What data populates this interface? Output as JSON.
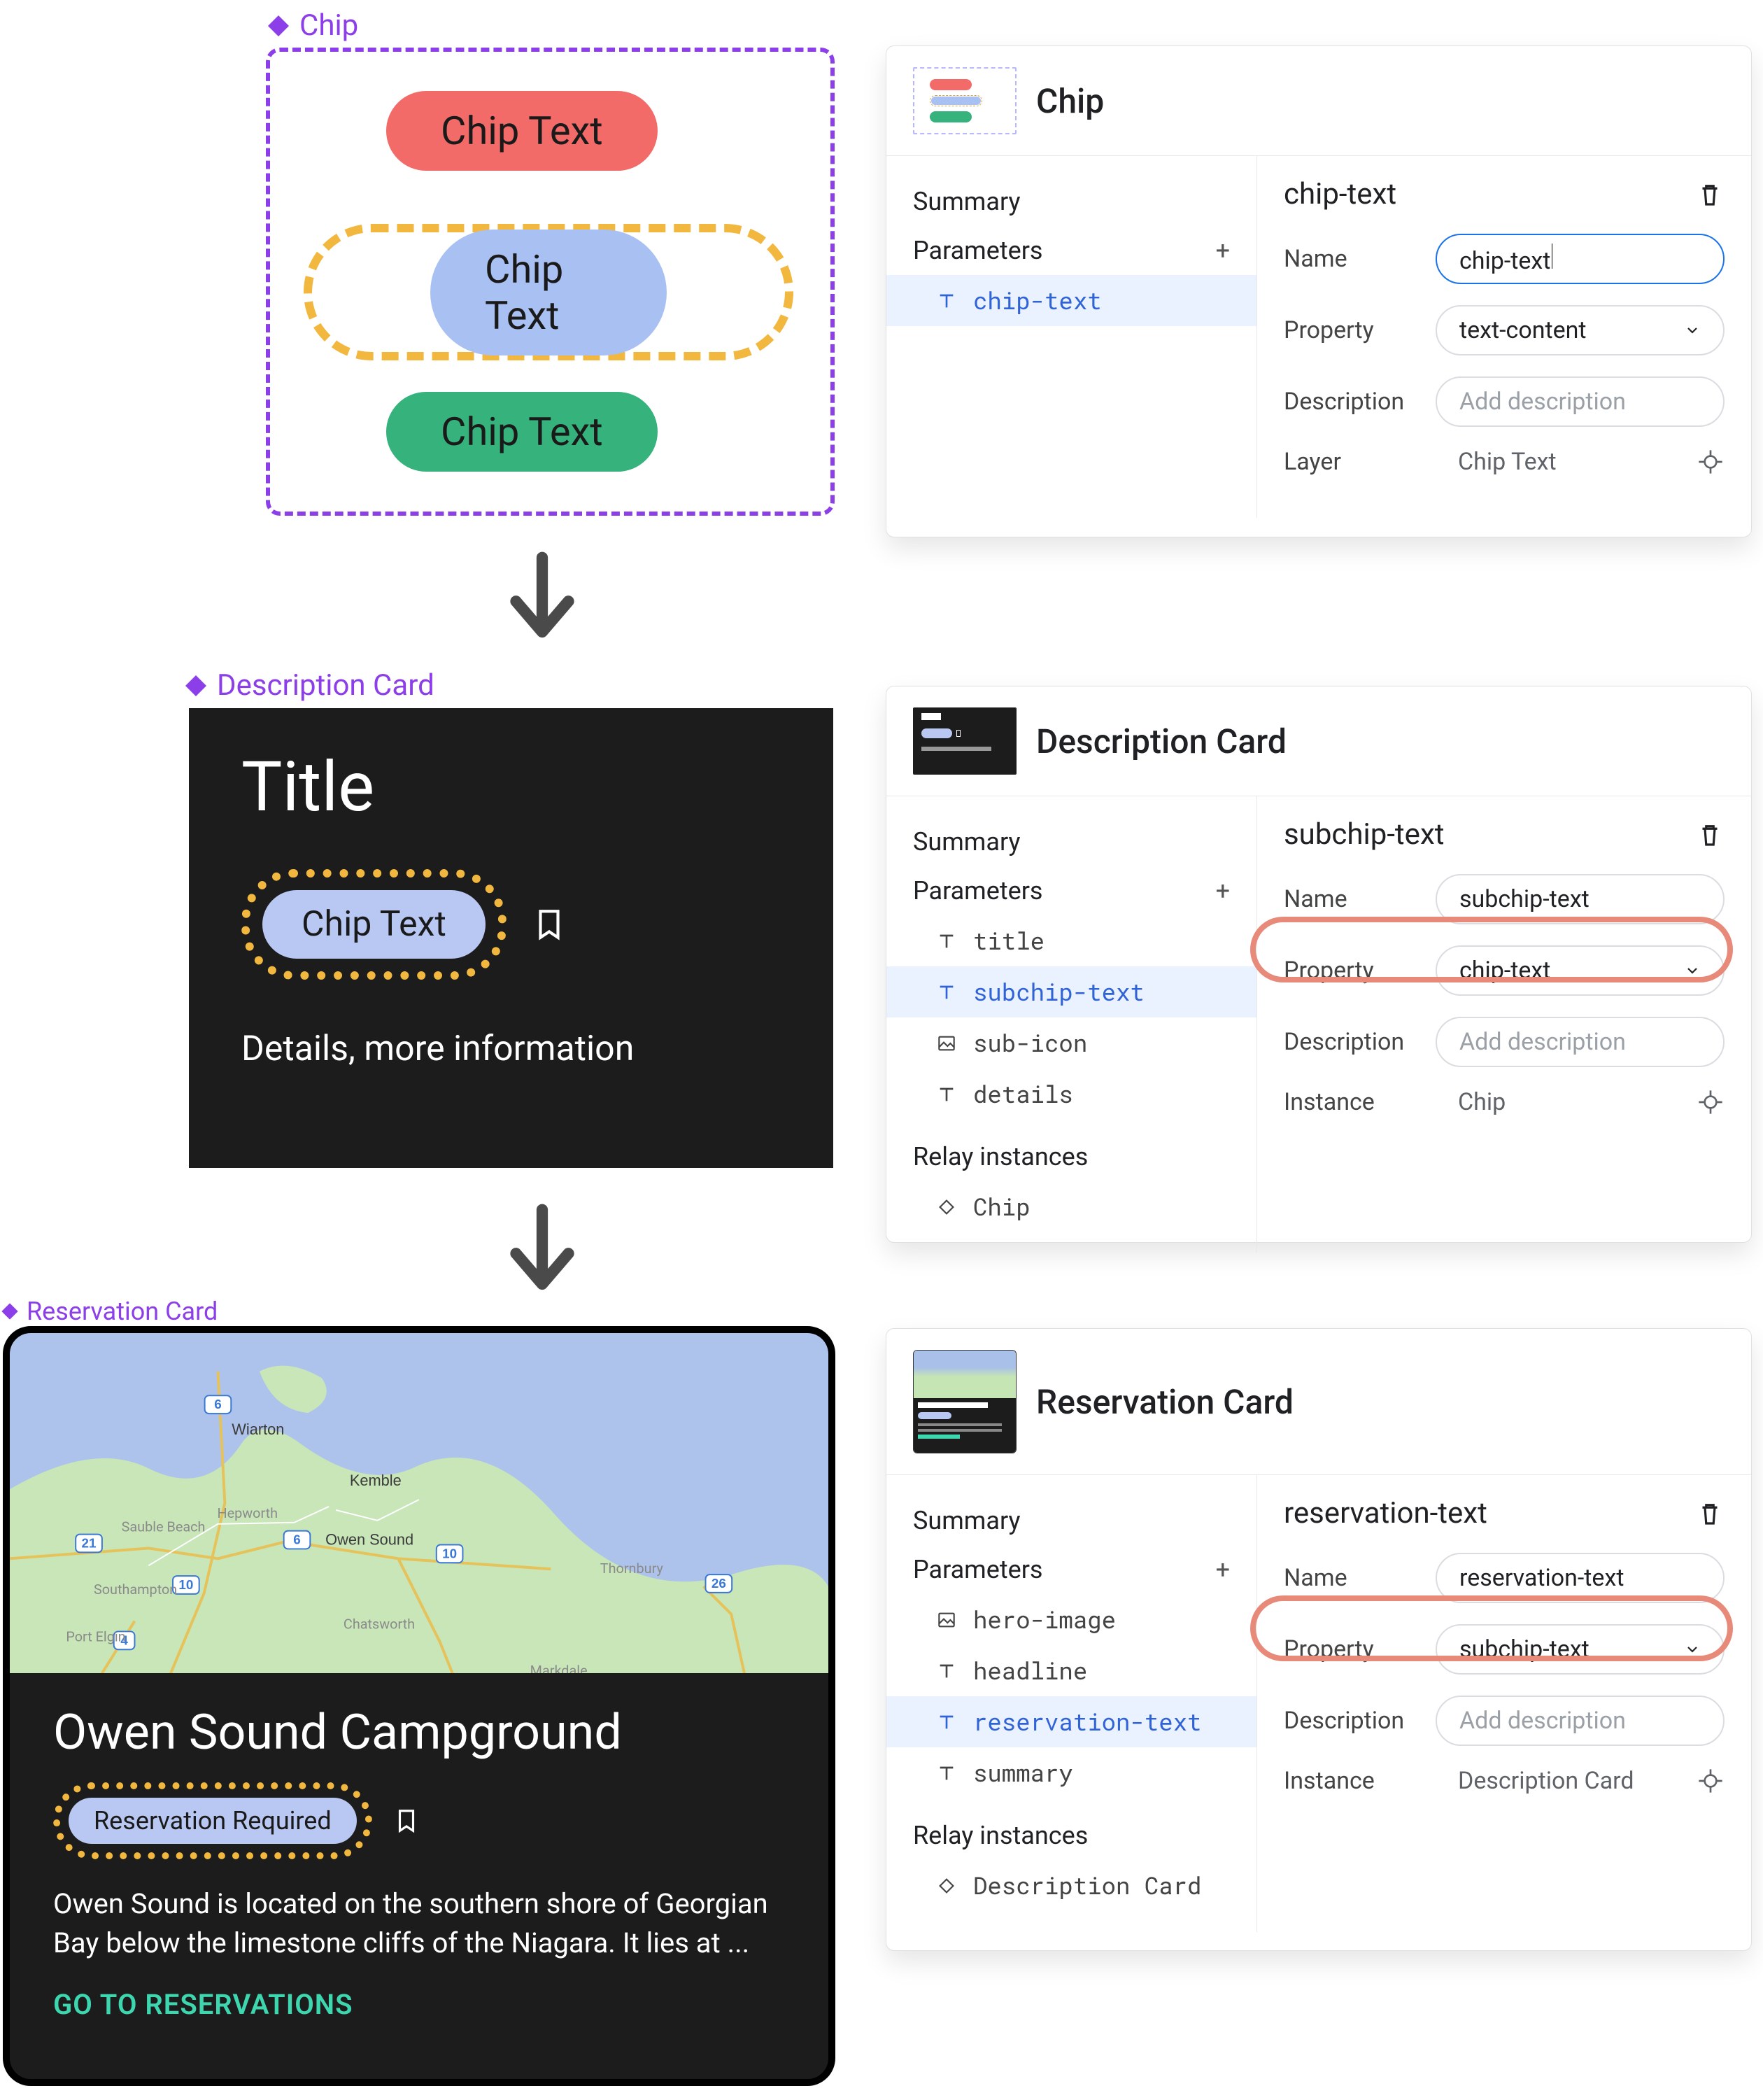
{
  "chip": {
    "label": "Chip",
    "red_text": "Chip Text",
    "blue_text": "Chip Text",
    "green_text": "Chip Text"
  },
  "description_card": {
    "label": "Description Card",
    "title": "Title",
    "chip_text": "Chip Text",
    "details": "Details, more information"
  },
  "reservation_card": {
    "label": "Reservation Card",
    "headline": "Owen Sound Campground",
    "chip_text": "Reservation Required",
    "summary": "Owen Sound is located on the southern shore of Georgian Bay below the limestone cliffs of the Niagara. It lies at ...",
    "cta": "GO TO RESERVATIONS",
    "map_places": [
      "Wiarton",
      "Kemble",
      "Sauble Beach",
      "Hepworth",
      "Owen Sound",
      "Southampton",
      "Chatsworth",
      "Port Elgin",
      "Markdale",
      "Thornbury"
    ],
    "map_roads": [
      "6",
      "10",
      "21",
      "6",
      "10",
      "26",
      "4"
    ]
  },
  "panel_chip": {
    "title": "Chip",
    "summary": "Summary",
    "parameters": "Parameters",
    "items": [
      {
        "icon": "text",
        "label": "chip-text",
        "selected": true
      }
    ],
    "detail": {
      "title": "chip-text",
      "name_label": "Name",
      "name_value": "chip-text",
      "property_label": "Property",
      "property_value": "text-content",
      "description_label": "Description",
      "description_placeholder": "Add description",
      "layer_label": "Layer",
      "layer_value": "Chip Text"
    }
  },
  "panel_desc": {
    "title": "Description Card",
    "summary": "Summary",
    "parameters": "Parameters",
    "relay_instances": "Relay instances",
    "items": [
      {
        "icon": "text",
        "label": "title",
        "selected": false
      },
      {
        "icon": "text",
        "label": "subchip-text",
        "selected": true
      },
      {
        "icon": "image",
        "label": "sub-icon",
        "selected": false
      },
      {
        "icon": "text",
        "label": "details",
        "selected": false
      }
    ],
    "relay_items": [
      {
        "icon": "instance",
        "label": "Chip"
      }
    ],
    "detail": {
      "title": "subchip-text",
      "name_label": "Name",
      "name_value": "subchip-text",
      "property_label": "Property",
      "property_value": "chip-text",
      "description_label": "Description",
      "description_placeholder": "Add description",
      "instance_label": "Instance",
      "instance_value": "Chip"
    }
  },
  "panel_res": {
    "title": "Reservation Card",
    "summary": "Summary",
    "parameters": "Parameters",
    "relay_instances": "Relay instances",
    "items": [
      {
        "icon": "image",
        "label": "hero-image",
        "selected": false
      },
      {
        "icon": "text",
        "label": "headline",
        "selected": false
      },
      {
        "icon": "text",
        "label": "reservation-text",
        "selected": true
      },
      {
        "icon": "text",
        "label": "summary",
        "selected": false
      }
    ],
    "relay_items": [
      {
        "icon": "instance",
        "label": "Description Card"
      }
    ],
    "detail": {
      "title": "reservation-text",
      "name_label": "Name",
      "name_value": "reservation-text",
      "property_label": "Property",
      "property_value": "subchip-text",
      "description_label": "Description",
      "description_placeholder": "Add description",
      "instance_label": "Instance",
      "instance_value": "Description Card"
    }
  }
}
